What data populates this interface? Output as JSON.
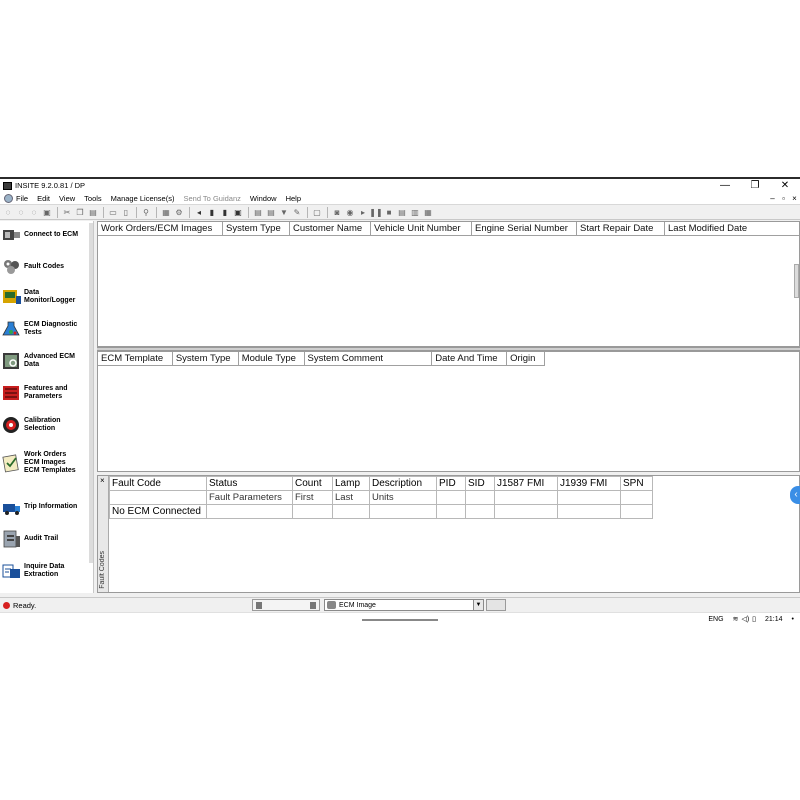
{
  "window": {
    "title": "INSITE 9.2.0.81  / DP",
    "controls": [
      "—",
      "❐",
      "✕"
    ],
    "mdi_controls": [
      "–",
      "▫",
      "×"
    ]
  },
  "menu": {
    "items": [
      {
        "label": "File",
        "enabled": true
      },
      {
        "label": "Edit",
        "enabled": true
      },
      {
        "label": "View",
        "enabled": true
      },
      {
        "label": "Tools",
        "enabled": true
      },
      {
        "label": "Manage License(s)",
        "enabled": true
      },
      {
        "label": "Send To Guidanz",
        "enabled": false
      },
      {
        "label": "Window",
        "enabled": true
      },
      {
        "label": "Help",
        "enabled": true
      }
    ]
  },
  "sidebar": {
    "items": [
      {
        "label": "Connect to ECM",
        "icon": "connect-ecm-icon"
      },
      {
        "label": "Fault Codes",
        "icon": "fault-codes-icon"
      },
      {
        "label": "Data\nMonitor/Logger",
        "icon": "data-monitor-icon"
      },
      {
        "label": "ECM Diagnostic\nTests",
        "icon": "diagnostic-tests-icon"
      },
      {
        "label": "Advanced ECM\nData",
        "icon": "advanced-data-icon"
      },
      {
        "label": "Features and\nParameters",
        "icon": "features-parameters-icon"
      },
      {
        "label": "Calibration\nSelection",
        "icon": "calibration-icon"
      },
      {
        "label": "Work Orders\nECM Images\nECM Templates",
        "icon": "work-orders-icon"
      },
      {
        "label": "Trip Information",
        "icon": "trip-info-icon"
      },
      {
        "label": "Audit Trail",
        "icon": "audit-trail-icon"
      },
      {
        "label": "Inquire Data\nExtraction",
        "icon": "inquire-data-icon"
      }
    ]
  },
  "work_orders_grid": {
    "columns": [
      "Work Orders/ECM Images",
      "System Type",
      "Customer Name",
      "Vehicle Unit Number",
      "Engine Serial Number",
      "Start Repair Date",
      "Last Modified Date"
    ]
  },
  "templates_grid": {
    "columns": [
      "ECM Template",
      "System Type",
      "Module Type",
      "System Comment",
      "Date And Time",
      "Origin"
    ]
  },
  "fault_codes": {
    "tab_label": "Fault Codes",
    "close": "×",
    "header1": [
      "Fault Code",
      "Status",
      "Count",
      "Lamp",
      "Description",
      "PID",
      "SID",
      "J1587 FMI",
      "J1939 FMI",
      "SPN"
    ],
    "header2": [
      "",
      "Fault Parameters",
      "First",
      "Last",
      "Units",
      "",
      "",
      "",
      "",
      ""
    ],
    "rows": [
      [
        "No ECM Connected",
        "",
        "",
        "",
        "",
        "",
        "",
        "",
        "",
        ""
      ]
    ]
  },
  "status": {
    "text": "Ready.",
    "ecm_select_value": "ECM Image"
  },
  "tray": {
    "language": "ENG",
    "time": "21:14"
  },
  "colors": {
    "status_dot": "#d62020",
    "collapse_button": "#3a8ee6"
  }
}
